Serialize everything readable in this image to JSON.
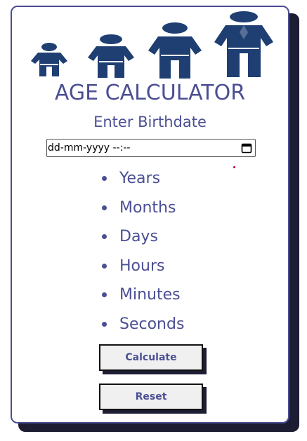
{
  "header": {
    "title": "AGE CALCULATOR",
    "subtitle": "Enter Birthdate"
  },
  "date_field": {
    "value": "dd-mm-yyyy --:--",
    "icon": "calendar-icon"
  },
  "units": [
    "Years",
    "Months",
    "Days",
    "Hours",
    "Minutes",
    "Seconds"
  ],
  "buttons": {
    "calculate": "Calculate",
    "reset": "Reset"
  },
  "colors": {
    "accent": "#4b4f93",
    "figure": "#1f3f73",
    "shadow": "#1c1c33"
  }
}
